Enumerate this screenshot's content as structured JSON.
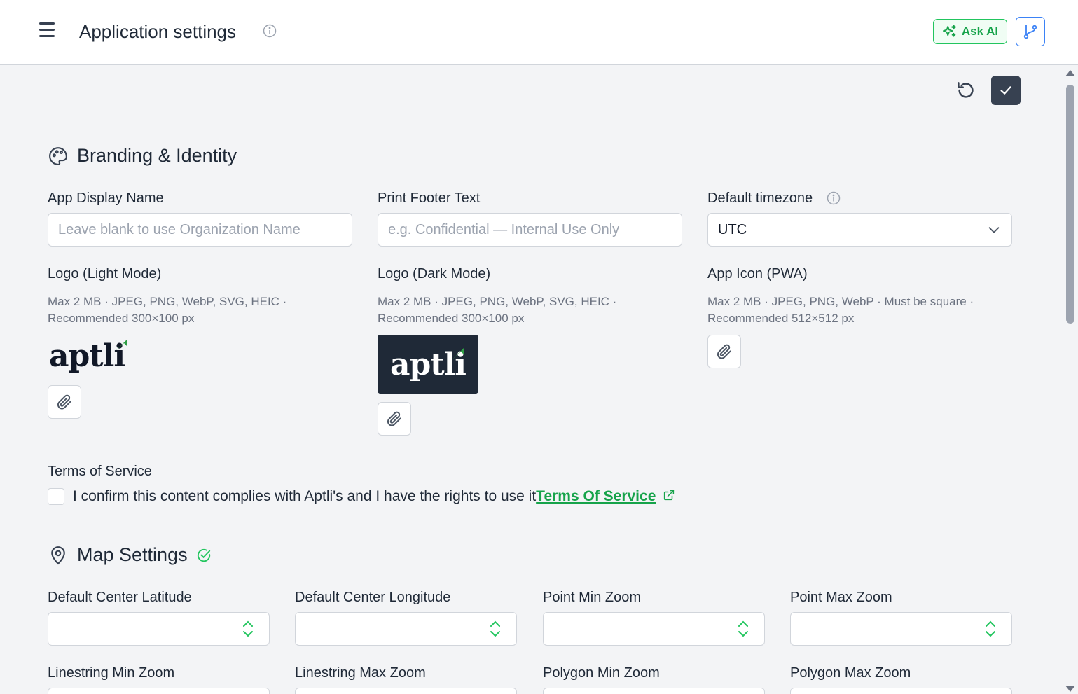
{
  "header": {
    "title": "Application settings",
    "ask_ai_label": "Ask AI",
    "accent": "#22c55e"
  },
  "branding": {
    "heading": "Branding & Identity",
    "app_display_name": {
      "label": "App Display Name",
      "placeholder": "Leave blank to use Organization Name",
      "value": ""
    },
    "print_footer": {
      "label": "Print Footer Text",
      "placeholder": "e.g. Confidential — Internal Use Only",
      "value": ""
    },
    "timezone": {
      "label": "Default timezone",
      "value": "UTC"
    },
    "logo_light": {
      "label": "Logo (Light Mode)",
      "hint": "Max 2 MB · JPEG, PNG, WebP, SVG, HEIC · Recommended 300×100 px",
      "logo_text": "aptli"
    },
    "logo_dark": {
      "label": "Logo (Dark Mode)",
      "hint": "Max 2 MB · JPEG, PNG, WebP, SVG, HEIC · Recommended 300×100 px",
      "logo_text": "aptli"
    },
    "app_icon": {
      "label": "App Icon (PWA)",
      "hint": "Max 2 MB · JPEG, PNG, WebP · Must be square · Recommended 512×512 px"
    },
    "tos": {
      "label": "Terms of Service",
      "confirm_text": "I confirm this content complies with Aptli's and I have the rights to use it",
      "link_text": "Terms Of Service",
      "checked": false
    }
  },
  "map": {
    "heading": "Map Settings",
    "fields": [
      {
        "label": "Default Center Latitude",
        "value": ""
      },
      {
        "label": "Default Center Longitude",
        "value": ""
      },
      {
        "label": "Point Min Zoom",
        "value": ""
      },
      {
        "label": "Point Max Zoom",
        "value": ""
      },
      {
        "label": "Linestring Min Zoom",
        "value": ""
      },
      {
        "label": "Linestring Max Zoom",
        "value": ""
      },
      {
        "label": "Polygon Min Zoom",
        "value": ""
      },
      {
        "label": "Polygon Max Zoom",
        "value": ""
      }
    ]
  }
}
